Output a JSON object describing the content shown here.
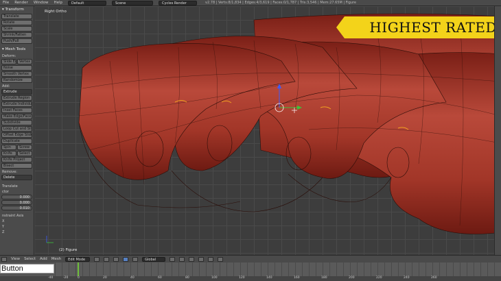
{
  "topbar": {
    "menus": [
      "File",
      "Render",
      "Window",
      "Help"
    ],
    "layout": "Default",
    "scene": "Scene",
    "engine": "Cycles Render",
    "stats": "v2.78 | Verts:8/1,834 | Edges:4/3,619 | Faces:0/1,787 | Tris:3,546 | Mem:27.65M | Figure"
  },
  "toolshelf": {
    "transform_title": "▾ Transform",
    "transform": [
      "Translate",
      "Rotate",
      "Scale",
      "Shrink/Fatten",
      "Push/Pull"
    ],
    "mesh_title": "▾ Mesh Tools",
    "deform_label": "Deform:",
    "slide": [
      "Slide Ed",
      "Vertex"
    ],
    "deform": [
      "Noise",
      "Smooth Vertex",
      "Randomize"
    ],
    "add_label": "Add:",
    "extrude": "Extrude",
    "add": [
      "Extrude Region",
      "Extrude Individual",
      "Inset Faces",
      "Make Edge/Face",
      "Subdivide",
      "Loop Cut and Slide",
      "Offset Edge Slide",
      "Duplicate"
    ],
    "pairs": [
      [
        "Spin",
        "Screw"
      ],
      [
        "Knife",
        "Select"
      ]
    ],
    "knife_project": "Knife Project",
    "bisect": "Bisect",
    "remove_label": "Remove:",
    "delete": "Delete",
    "translate_label": "Translate",
    "vector_label": "ctor",
    "vector": [
      "0.000",
      "0.000",
      "0.010"
    ],
    "constraint_label": "nstraint Axis",
    "axes": [
      "X",
      "Y",
      "Z"
    ]
  },
  "viewport": {
    "view_label": "Right Ortho",
    "object_label": "(2) Figure",
    "banner": "HIGHEST RATED"
  },
  "header": {
    "menus": [
      "View",
      "Select",
      "Add",
      "Mesh"
    ],
    "mode": "Edit Mode",
    "orientation": "Global"
  },
  "timeline": {
    "button_label": "Button",
    "ticks": [
      "-40",
      "-20",
      "0",
      "20",
      "40",
      "60",
      "80",
      "100",
      "120",
      "140",
      "160",
      "180",
      "200",
      "220",
      "240",
      "260"
    ]
  },
  "colors": {
    "mesh": "#a8382a",
    "banner": "#f3d31a",
    "frame_cursor": "#6fbf3a"
  }
}
